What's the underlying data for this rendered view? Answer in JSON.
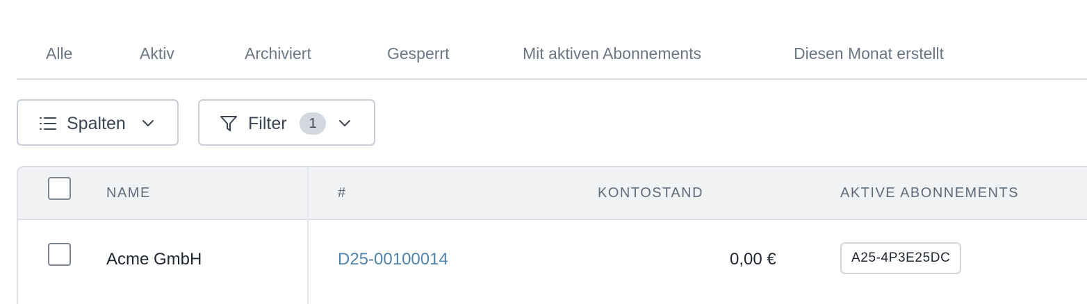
{
  "tabs": [
    {
      "label": "Alle"
    },
    {
      "label": "Aktiv"
    },
    {
      "label": "Archiviert"
    },
    {
      "label": "Gesperrt"
    },
    {
      "label": "Mit aktiven Abonnements"
    },
    {
      "label": "Diesen Monat erstellt"
    }
  ],
  "toolbar": {
    "columns_label": "Spalten",
    "columns_icon": "list-icon",
    "filter_label": "Filter",
    "filter_icon": "funnel-icon",
    "filter_count": "1",
    "chevron_icon": "chevron-down-icon"
  },
  "table": {
    "headers": {
      "name": "NAME",
      "number": "#",
      "balance": "KONTOSTAND",
      "subscriptions": "AKTIVE ABONNEMENTS"
    },
    "rows": [
      {
        "name": "Acme GmbH",
        "number": "D25-00100014",
        "balance": "0,00 €",
        "subscription": "A25-4P3E25DC"
      }
    ]
  },
  "colors": {
    "tab_text": "#6b7684",
    "link": "#4d85ad",
    "border": "#d9dde3",
    "header_bg": "#f1f2f4"
  }
}
